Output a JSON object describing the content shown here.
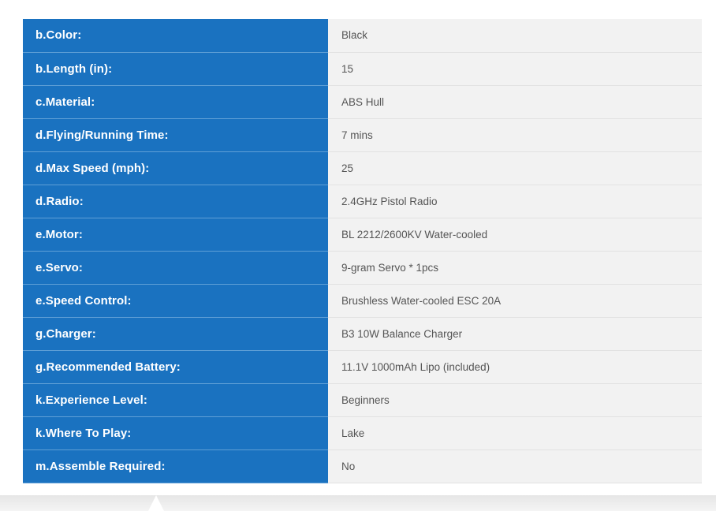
{
  "specs": [
    {
      "label": "b.Color:",
      "value": "Black"
    },
    {
      "label": "b.Length (in):",
      "value": "15"
    },
    {
      "label": "c.Material:",
      "value": "ABS Hull"
    },
    {
      "label": "d.Flying/Running Time:",
      "value": "7 mins"
    },
    {
      "label": "d.Max Speed (mph):",
      "value": "25"
    },
    {
      "label": "d.Radio:",
      "value": "2.4GHz Pistol Radio"
    },
    {
      "label": "e.Motor:",
      "value": "BL 2212/2600KV Water-cooled"
    },
    {
      "label": "e.Servo:",
      "value": "9-gram Servo * 1pcs"
    },
    {
      "label": "e.Speed Control:",
      "value": "Brushless Water-cooled ESC 20A"
    },
    {
      "label": "g.Charger:",
      "value": "B3 10W Balance Charger"
    },
    {
      "label": "g.Recommended Battery:",
      "value": "11.1V 1000mAh Lipo (included)"
    },
    {
      "label": "k.Experience Level:",
      "value": "Beginners"
    },
    {
      "label": "k.Where To Play:",
      "value": "Lake"
    },
    {
      "label": "m.Assemble Required:",
      "value": "No"
    }
  ],
  "colors": {
    "label_background": "#1a72c0",
    "value_background": "#f2f2f2",
    "label_text": "#ffffff",
    "value_text": "#555555"
  }
}
